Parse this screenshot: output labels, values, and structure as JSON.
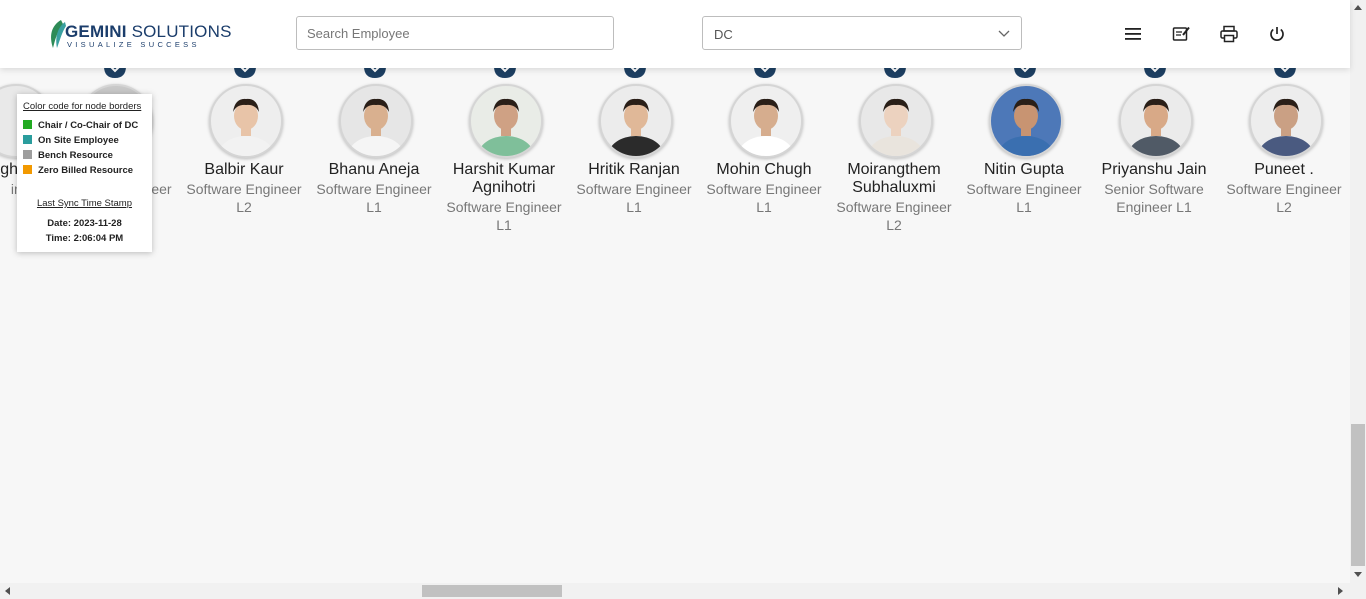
{
  "header": {
    "logo": {
      "brand_bold": "GEMINI",
      "brand_rest": " SOLUTIONS",
      "tagline": "VISUALIZE SUCCESS"
    },
    "search": {
      "placeholder": "Search Employee",
      "value": ""
    },
    "department_select": {
      "value": "DC"
    },
    "icons": [
      "menu-icon",
      "edit-note-icon",
      "print-icon",
      "power-icon"
    ]
  },
  "legend": {
    "heading": "Color code for node borders",
    "items": [
      {
        "label": "Chair / Co-Chair of DC",
        "color": "#22aa22"
      },
      {
        "label": "On Site Employee",
        "color": "#2a9d9d"
      },
      {
        "label": "Bench Resource",
        "color": "#9e9e9e"
      },
      {
        "label": "Zero Billed Resource",
        "color": "#f29900"
      }
    ],
    "sync_heading": "Last Sync Time Stamp",
    "date": "Date: 2023-11-28",
    "time": "Time: 2:06:04 PM"
  },
  "partial_nodes": [
    {
      "name": "gh",
      "title": "ineer"
    },
    {
      "name": "",
      "title": "Software Engineer"
    }
  ],
  "employees": [
    {
      "name": "Balbir Kaur",
      "title": "Software Engineer L2"
    },
    {
      "name": "Bhanu Aneja",
      "title": "Software Engineer L1"
    },
    {
      "name": "Harshit Kumar Agnihotri",
      "title": "Software Engineer L1"
    },
    {
      "name": "Hritik Ranjan",
      "title": "Software Engineer L1"
    },
    {
      "name": "Mohin Chugh",
      "title": "Software Engineer L1"
    },
    {
      "name": "Moirangthem Subhaluxmi",
      "title": "Software Engineer L2"
    },
    {
      "name": "Nitin Gupta",
      "title": "Software Engineer L1"
    },
    {
      "name": "Priyanshu Jain",
      "title": "Senior Software Engineer L1"
    },
    {
      "name": "Puneet .",
      "title": "Software Engineer L2"
    }
  ],
  "colors": {
    "cap": "#1d3f62",
    "accent": "#1b3d6b"
  }
}
